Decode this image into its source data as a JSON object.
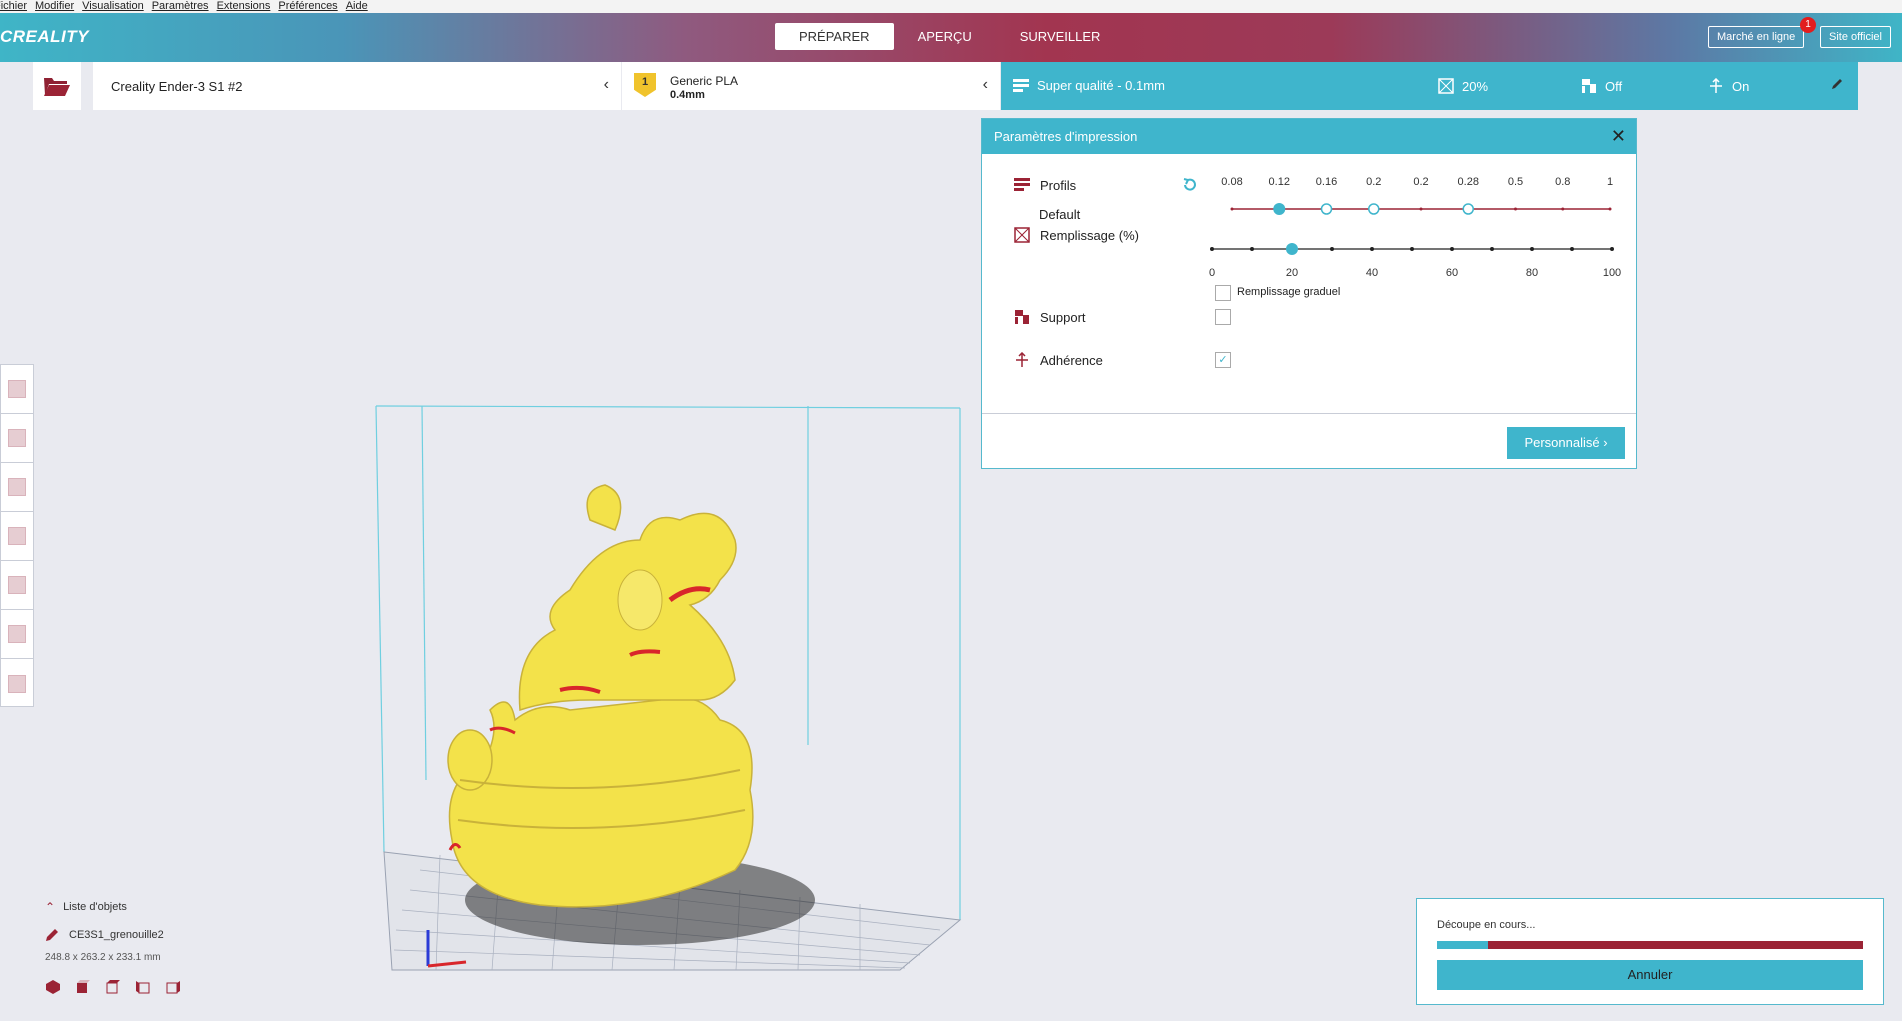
{
  "menubar": [
    "Fichier",
    "Modifier",
    "Visualisation",
    "Paramètres",
    "Extensions",
    "Préférences",
    "Aide"
  ],
  "header": {
    "logo": "CREALITY",
    "tabs": [
      "PRÉPARER",
      "APERÇU",
      "SURVEILLER"
    ],
    "active_tab": "PRÉPARER",
    "market_button": "Marché en ligne",
    "notification_count": "1",
    "site_button": "Site officiel"
  },
  "toolbar": {
    "printer": "Creality Ender-3 S1 #2",
    "material_slot": "1",
    "material_name": "Generic PLA",
    "nozzle": "0.4mm",
    "quality": "Super qualité - 0.1mm",
    "infill": "20%",
    "support": "Off",
    "adhesion": "On"
  },
  "panel": {
    "title": "Paramètres d'impression",
    "profiles_label": "Profils",
    "profile_name": "Default",
    "profile_ticks": [
      "0.08",
      "0.12",
      "0.16",
      "0.2",
      "0.2",
      "0.28",
      "0.5",
      "0.8",
      "1"
    ],
    "profile_selected_index": 1,
    "infill_label": "Remplissage (%)",
    "infill_ticks": [
      "0",
      "20",
      "40",
      "60",
      "80",
      "100"
    ],
    "infill_value": 20,
    "gradual_label": "Remplissage graduel",
    "gradual_checked": false,
    "support_label": "Support",
    "support_checked": false,
    "adhesion_label": "Adhérence",
    "adhesion_checked": true,
    "custom_button": "Personnalisé"
  },
  "objects": {
    "toggle_label": "Liste d'objets",
    "object_name": "CE3S1_grenouille2",
    "dimensions": "248.8 x 263.2 x 233.1 mm"
  },
  "slicing": {
    "status": "Découpe en cours...",
    "progress": 0.12,
    "cancel_button": "Annuler"
  },
  "colors": {
    "accent": "#3fb5cc",
    "brand_red": "#9b2335",
    "model_yellow": "#f3e24a"
  }
}
